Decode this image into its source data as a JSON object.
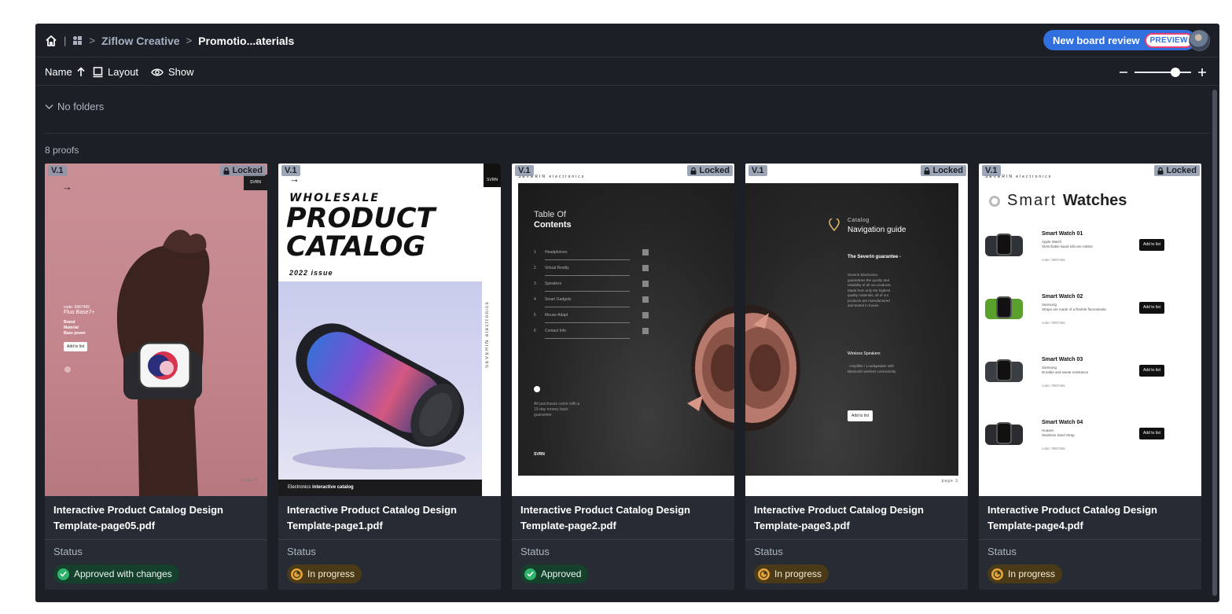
{
  "breadcrumb": {
    "workspace": "Ziflow Creative",
    "folder": "Promotio...aterials"
  },
  "header": {
    "new_review_label": "New board review",
    "preview_label": "PREVIEW"
  },
  "toolbar": {
    "sort_label": "Name",
    "layout_label": "Layout",
    "show_label": "Show",
    "zoom_level": 0.72
  },
  "folders": {
    "label": "No folders"
  },
  "proofs": {
    "count_label": "8 proofs",
    "items": [
      {
        "version": "V.1",
        "locked": true,
        "lock_label": "Locked",
        "title": "Interactive Product Catalog Design Template-page05.pdf",
        "status_label": "Status",
        "status": "Approved with changes",
        "status_kind": "green",
        "thumb": {
          "code": "code: 0987465",
          "product": "Fluo Base7+",
          "brand_label": "Brand",
          "material_label": "Material",
          "bass_label": "Bass power",
          "button": "Add to list",
          "page": "page 5",
          "corner": "SVRN"
        }
      },
      {
        "version": "V.1",
        "locked": false,
        "lock_label": "",
        "title": "Interactive Product Catalog Design Template-page1.pdf",
        "status_label": "Status",
        "status": "In progress",
        "status_kind": "orange",
        "thumb": {
          "line1": "WHOLESALE",
          "line2": "PRODUCT",
          "line3": "CATALOG",
          "line4": "2022 issue",
          "side": "SEVERIN electronics",
          "footer_a": "Electronics",
          "footer_b": "interactive catalog",
          "corner": "SVRN"
        }
      },
      {
        "version": "V.1",
        "locked": true,
        "lock_label": "Locked",
        "title": "Interactive Product Catalog Design Template-page2.pdf",
        "status_label": "Status",
        "status": "Approved",
        "status_kind": "green",
        "thumb": {
          "brand": "SEVERIN electronics",
          "toc_a": "Table Of",
          "toc_b": "Contents",
          "toc": [
            "Headphones",
            "Virtual Reality",
            "Speakers",
            "Smart Gadgets",
            "Mouse Adapt",
            "Contact Info"
          ],
          "note": "All purchases come with a 15-day money back guarantee",
          "logo": "SVRN"
        }
      },
      {
        "version": "V.1",
        "locked": true,
        "lock_label": "Locked",
        "title": "Interactive Product Catalog Design Template-page3.pdf",
        "status_label": "Status",
        "status": "In progress",
        "status_kind": "orange",
        "thumb": {
          "kicker": "Catalog",
          "heading": "Navigation guide",
          "sub": "The Severin guarantee -",
          "body": "Severin Electronics guarantees the quality and reliability of all our products. Made from only the highest quality materials, all of our products are manufactured and tested in house.",
          "sub2": "Wireless Speakers",
          "body2": "- Amplifier / Loudspeaker with Bluetooth wireless connectivity",
          "button": "Add to list",
          "page": "page 3"
        }
      },
      {
        "version": "V.1",
        "locked": true,
        "lock_label": "Locked",
        "title": "Interactive Product Catalog Design Template-page4.pdf",
        "status_label": "Status",
        "status": "In progress",
        "status_kind": "orange",
        "thumb": {
          "brand": "SEVERIN electronics",
          "heading_a": "Smart",
          "heading_b": "Watches",
          "watches": [
            {
              "name": "Smart Watch 01",
              "brand": "Apple Watch",
              "material": "Stretchable liquid silicone rubber",
              "code": "code: 0987465",
              "button": "Add to list",
              "strap": "#2f3338"
            },
            {
              "name": "Smart Watch 02",
              "brand": "Samsung",
              "material": "Straps are made of a flexible fluoroelastic",
              "code": "code: 0987465",
              "button": "Add to list",
              "strap": "#5aa02c"
            },
            {
              "name": "Smart Watch 03",
              "brand": "Samsung",
              "material": "Durable and sweat resistance",
              "code": "code: 0987465",
              "button": "Add to list",
              "strap": "#3a3d42"
            },
            {
              "name": "Smart Watch 04",
              "brand": "Huawei",
              "material": "Stainless Steel Strap",
              "code": "code: 0987465",
              "button": "Add to list",
              "strap": "#2a2c30"
            }
          ]
        }
      }
    ]
  },
  "colors": {
    "app_bg": "#1c1f26",
    "card_bg": "#272b34",
    "accent": "#2f6fde",
    "approved": "#2fb36a",
    "in_progress": "#e3a43a"
  }
}
